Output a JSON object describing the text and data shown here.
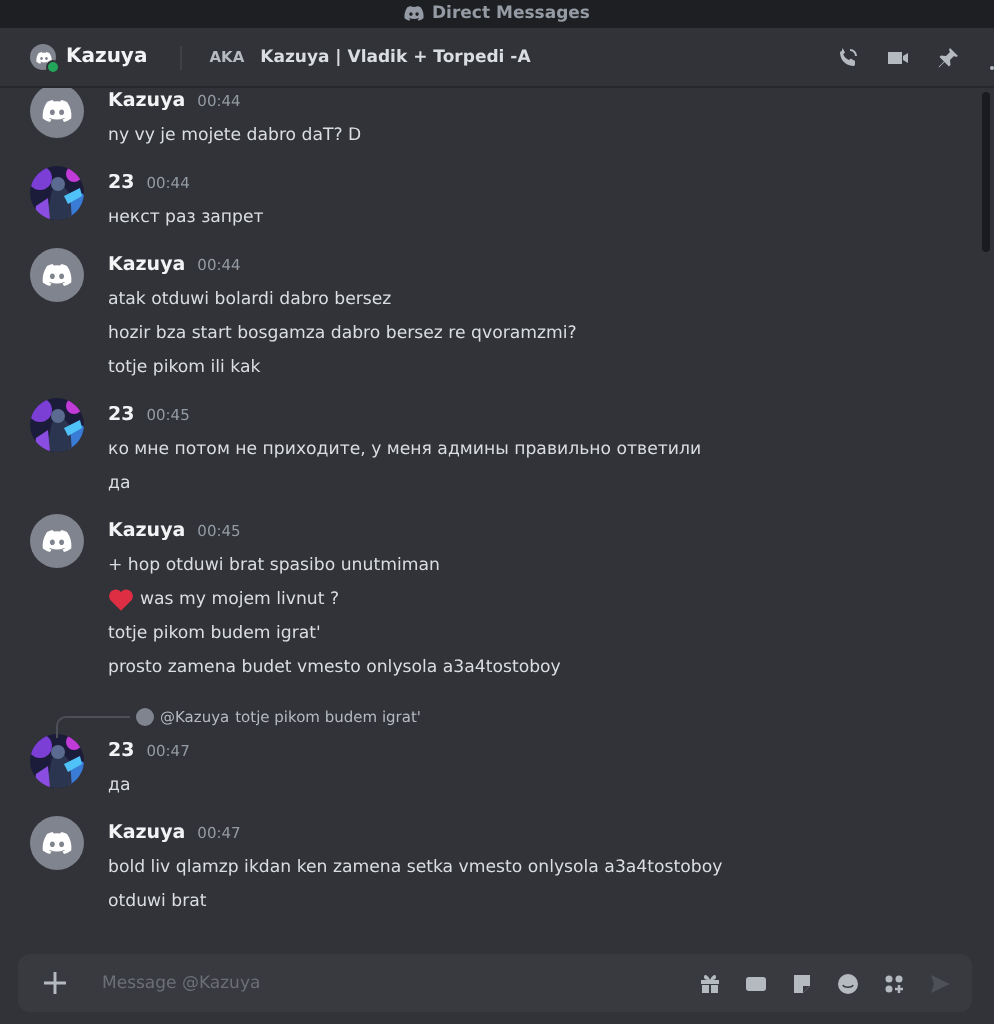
{
  "titlebar": {
    "title": "Direct Messages"
  },
  "header": {
    "name": "Kazuya",
    "online": true,
    "aka_label": "AKA",
    "aka": "Kazuya | Vladik + Torpedi -A"
  },
  "messages": [
    {
      "author": "Kazuya",
      "kind": "logo",
      "time": "00:44",
      "lines": [
        {
          "kind": "plain",
          "text": "ny vy je mojete dabro daT? D"
        }
      ]
    },
    {
      "author": "23",
      "time": "00:44",
      "lines": [
        {
          "kind": "plain",
          "text": "некст раз запрет"
        }
      ]
    },
    {
      "author": "Kazuya",
      "kind": "logo",
      "time": "00:44",
      "lines": [
        {
          "kind": "plain",
          "text": "atak otduwi bolardi dabro bersez"
        },
        {
          "kind": "plain",
          "text": "hozir bza start bosgamza dabro bersez re qvoramzmi?"
        },
        {
          "kind": "plain",
          "text": "totje pikom ili kak"
        }
      ]
    },
    {
      "author": "23",
      "time": "00:45",
      "lines": [
        {
          "kind": "plain",
          "text": "ко мне потом не приходите, у меня админы правильно ответили"
        },
        {
          "kind": "plain",
          "text": "да"
        }
      ]
    },
    {
      "author": "Kazuya",
      "kind": "logo",
      "time": "00:45",
      "lines": [
        {
          "kind": "plain",
          "text": "+ hop otduwi brat spasibo unutmiman"
        },
        {
          "kind": "heart",
          "text": "was my mojem livnut ?"
        },
        {
          "kind": "plain",
          "text": "totje pikom budem igrat'"
        },
        {
          "kind": "plain",
          "text": "prosto zamena budet vmesto onlysola a3a4tostoboy"
        }
      ]
    },
    {
      "author": "23",
      "time": "00:47",
      "reply": {
        "author": "@Kazuya",
        "text": "totje pikom budem igrat'"
      },
      "lines": [
        {
          "kind": "plain",
          "text": "да"
        }
      ]
    },
    {
      "author": "Kazuya",
      "kind": "logo",
      "time": "00:47",
      "lines": [
        {
          "kind": "plain",
          "text": "bold liv qlamzp ikdan ken zamena setka vmesto onlysola a3a4tostoboy"
        },
        {
          "kind": "plain",
          "text": "otduwi brat"
        }
      ]
    }
  ],
  "composer": {
    "placeholder": "Message @Kazuya"
  }
}
